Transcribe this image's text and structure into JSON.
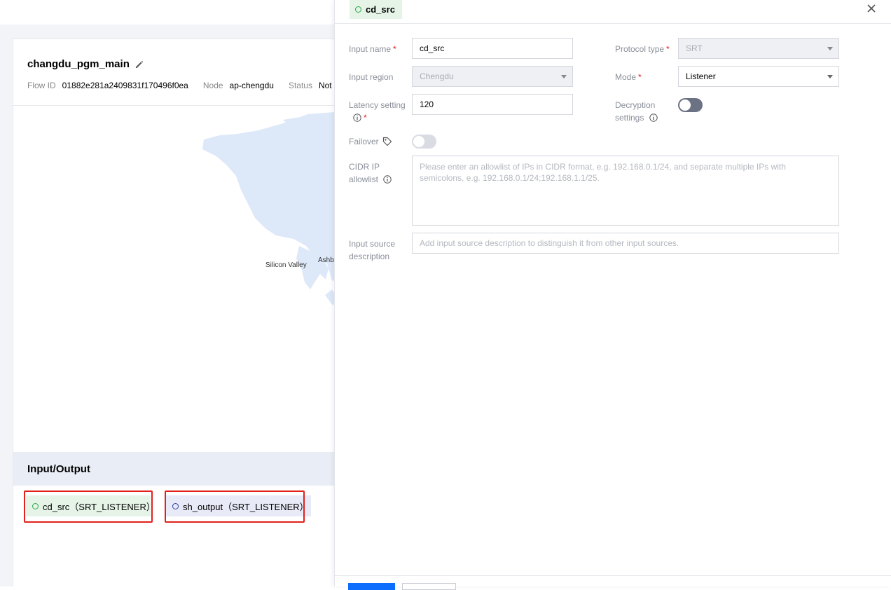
{
  "flow": {
    "name": "changdu_pgm_main",
    "flow_id_label": "Flow ID",
    "flow_id": "01882e281a2409831f170496f0ea",
    "node_label": "Node",
    "node": "ap-chengdu",
    "status_label": "Status",
    "status": "Not st"
  },
  "map": {
    "labels": [
      "Silicon Valley",
      "Ashb"
    ]
  },
  "io": {
    "header": "Input/Output",
    "input_item": "cd_src（SRT_LISTENER）",
    "output_item": "sh_output（SRT_LISTENER）"
  },
  "drawer": {
    "tab_title": "cd_src",
    "fields": {
      "input_name": {
        "label": "Input name",
        "required": "*",
        "value": "cd_src"
      },
      "protocol_type": {
        "label": "Protocol type",
        "required": "*",
        "value": "SRT"
      },
      "input_region": {
        "label": "Input region",
        "value": "Chengdu"
      },
      "mode": {
        "label": "Mode",
        "required": "*",
        "value": "Listener"
      },
      "latency": {
        "label": "Latency setting",
        "required": "*",
        "value": "120"
      },
      "decryption": {
        "label_line1": "Decryption",
        "label_line2": "settings"
      },
      "failover": {
        "label": "Failover"
      },
      "cidr": {
        "label_line1": "CIDR IP",
        "label_line2": "allowlist",
        "placeholder": "Please enter an allowlist of IPs in CIDR format, e.g. 192.168.0.1/24, and separate multiple IPs with semicolons, e.g. 192.168.0.1/24;192.168.1.1/25."
      },
      "description": {
        "label_line1": "Input source",
        "label_line2": "description",
        "placeholder": "Add input source description to distinguish it from other input sources."
      }
    }
  },
  "colors": {
    "accent": "#0d6efd",
    "input_green": "#29a745",
    "output_blue": "#2c3ea8",
    "highlight_red": "#e2211c"
  }
}
